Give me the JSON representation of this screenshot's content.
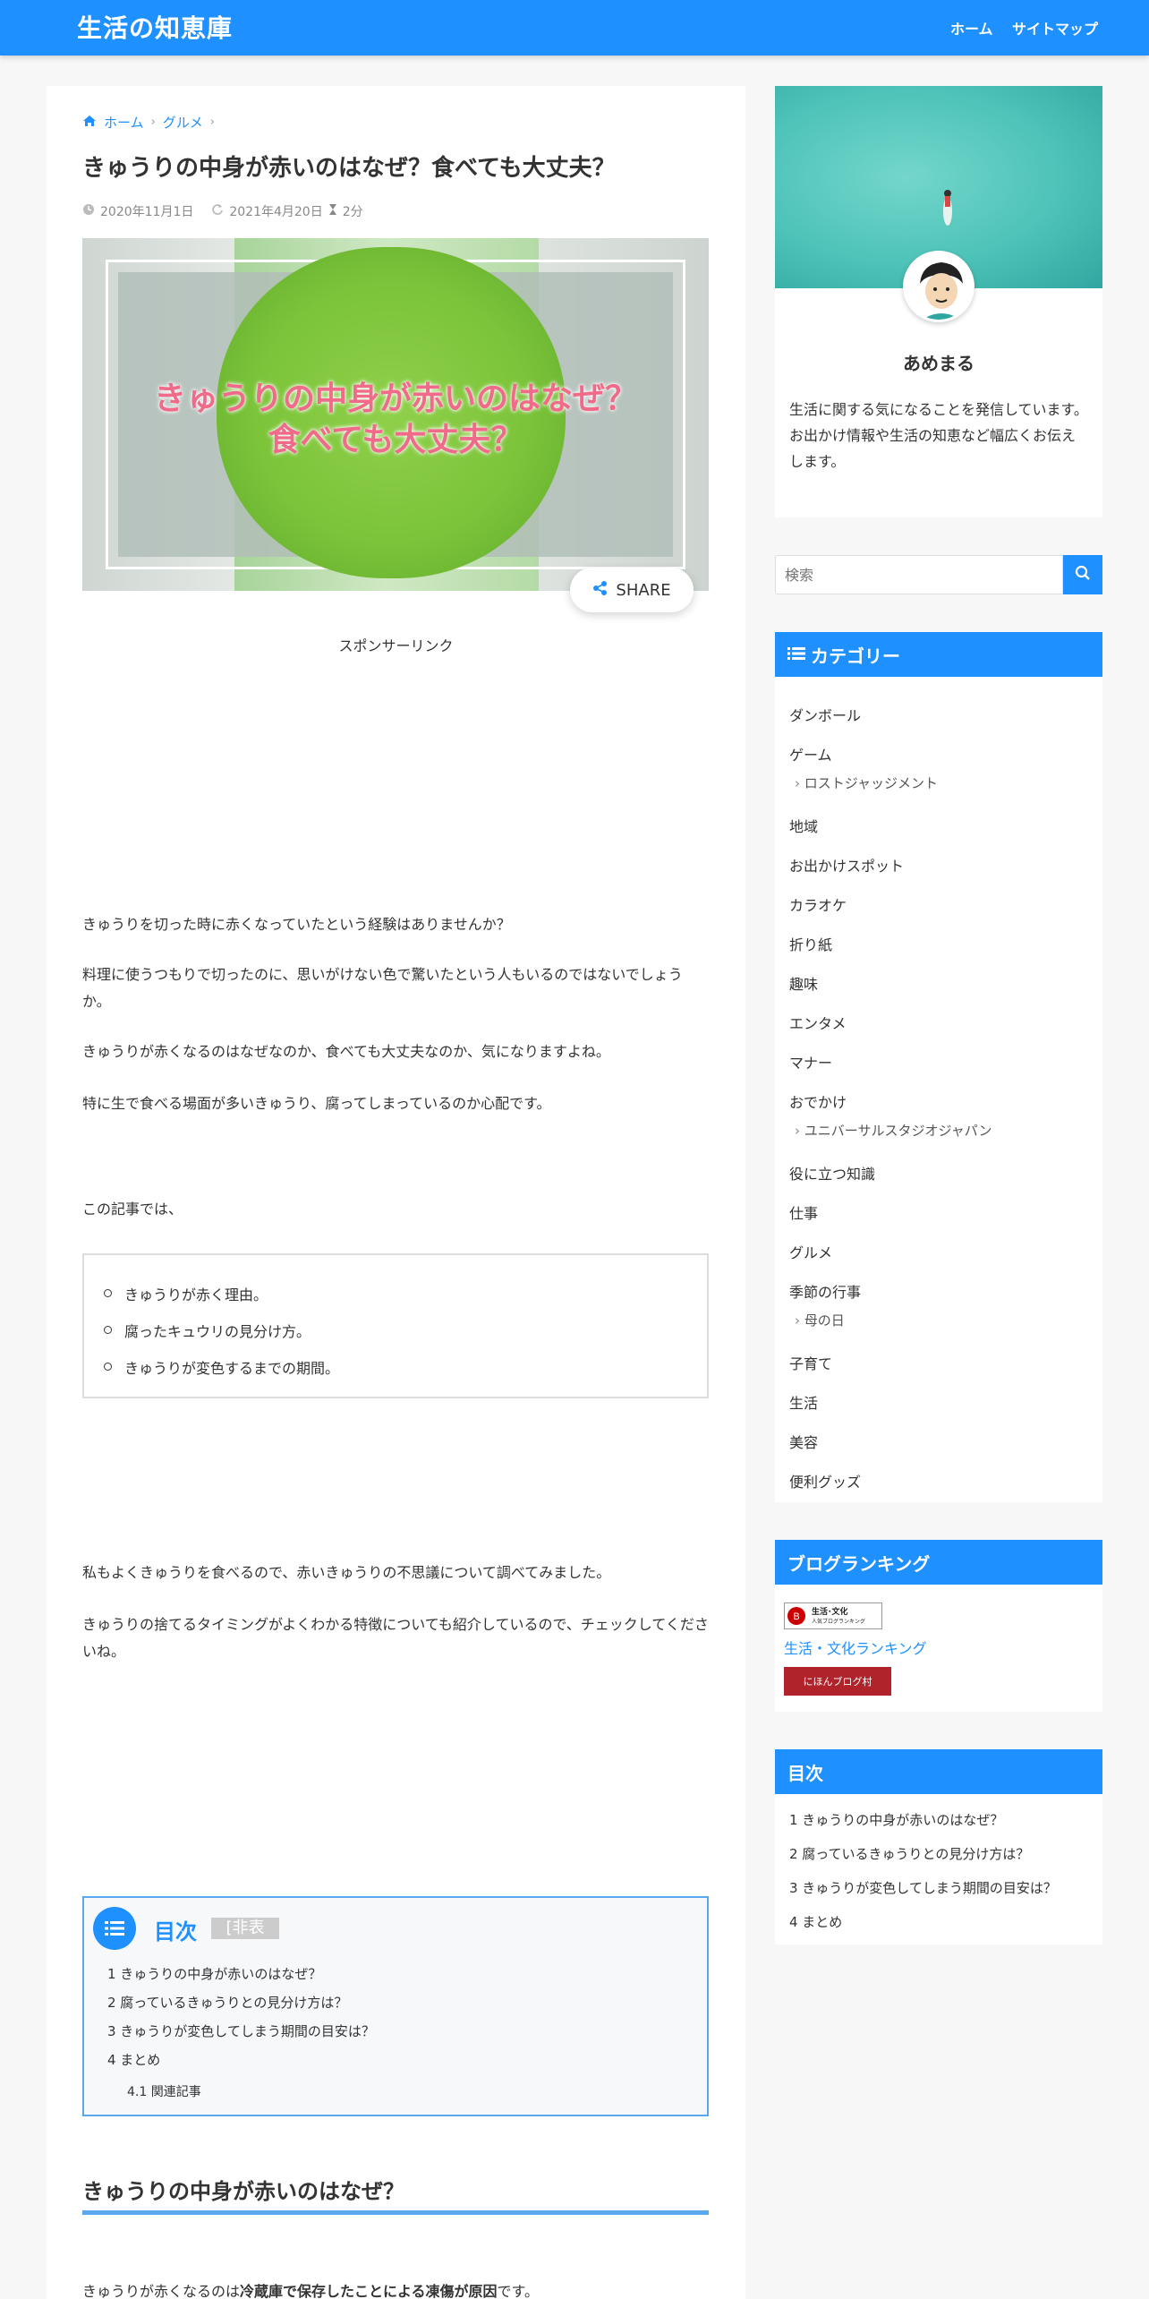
{
  "header": {
    "logo": "生活の知恵庫",
    "nav": [
      "ホーム",
      "サイトマップ"
    ]
  },
  "article": {
    "breadcrumb": [
      "ホーム",
      "グルメ"
    ],
    "title": "きゅうりの中身が赤いのはなぜ？食べても大丈夫？",
    "meta": {
      "published": "2020年11月1日",
      "updated": "2021年4月20日",
      "read_time": "2分"
    },
    "hero_text": [
      "きゅうりの中身が赤いのはなぜ？",
      "食べても大丈夫？"
    ],
    "share_label": "SHARE",
    "sponsor_label": "スポンサーリンク",
    "paragraphs": [
      "きゅうりを切った時に赤くなっていたという経験はありませんか？",
      "料理に使うつもりで切ったのに、思いがけない色で驚いたという人もいるのではないでしょうか。",
      "きゅうりが赤くなるのはなぜなのか、食べても大丈夫なのか、気になりますよね。",
      "特に生で食べる場面が多いきゅうり、腐ってしまっているのか心配です。",
      "この記事では、",
      "私もよくきゅうりを食べるので、赤いきゅうりの不思議について調べてみました。",
      "きゅうりの捨てるタイミングがよくわかる特徴についても紹介しているので、チェックしてくださいね。"
    ],
    "list": [
      "きゅうりが赤く理由。",
      "腐ったキュウリの見分け方。",
      "きゅうりが変色するまでの期間。"
    ],
    "toc": {
      "title": "目次",
      "toggle": "[非表",
      "items": [
        "1 きゅうりの中身が赤いのはなぜ？",
        "2 腐っているきゅうりとの見分け方は？",
        "3 きゅうりが変色してしまう期間の目安は？",
        "4 まとめ"
      ],
      "sub_number": "4.1",
      "sub_text": "関連記事"
    },
    "h2": "きゅうりの中身が赤いのはなぜ？",
    "last_line": {
      "pre": "きゅうりが赤くなるのは",
      "bold": "冷蔵庫で保存したことによる凍傷が原因",
      "post": "です。"
    }
  },
  "sidebar": {
    "profile": {
      "name": "あめまる",
      "desc": "生活に関する気になることを発信しています。お出かけ情報や生活の知恵など幅広くお伝えします。"
    },
    "search_placeholder": "検索",
    "categories": {
      "title": "カテゴリー",
      "items": [
        {
          "label": "ダンボール",
          "sub": false
        },
        {
          "label": "ゲーム",
          "sub": false
        },
        {
          "label": "ロストジャッジメント",
          "sub": true
        },
        {
          "label": "地域",
          "sub": false
        },
        {
          "label": "お出かけスポット",
          "sub": false
        },
        {
          "label": "カラオケ",
          "sub": false
        },
        {
          "label": "折り紙",
          "sub": false
        },
        {
          "label": "趣味",
          "sub": false
        },
        {
          "label": "エンタメ",
          "sub": false
        },
        {
          "label": "マナー",
          "sub": false
        },
        {
          "label": "おでかけ",
          "sub": false
        },
        {
          "label": "ユニバーサルスタジオジャパン",
          "sub": true
        },
        {
          "label": "役に立つ知識",
          "sub": false
        },
        {
          "label": "仕事",
          "sub": false
        },
        {
          "label": "グルメ",
          "sub": false
        },
        {
          "label": "季節の行事",
          "sub": false
        },
        {
          "label": "母の日",
          "sub": true
        },
        {
          "label": "子育て",
          "sub": false
        },
        {
          "label": "生活",
          "sub": false
        },
        {
          "label": "美容",
          "sub": false
        },
        {
          "label": "便利グッズ",
          "sub": false
        }
      ]
    },
    "ranking": {
      "title": "ブログランキング",
      "banner_text": [
        "生活･文化",
        "人気ブログランキング"
      ],
      "link": "生活・文化ランキング",
      "mura": "にほんブログ村"
    },
    "toc": {
      "title": "目次",
      "items": [
        "1 きゅうりの中身が赤いのはなぜ？",
        "2 腐っているきゅうりとの見分け方は？",
        "3 きゅうりが変色してしまう期間の目安は？",
        "4 まとめ"
      ]
    }
  },
  "colors": {
    "accent": "#1e90ff",
    "toc_border": "#5aa9f0",
    "hero_text": "#f06a8a"
  }
}
